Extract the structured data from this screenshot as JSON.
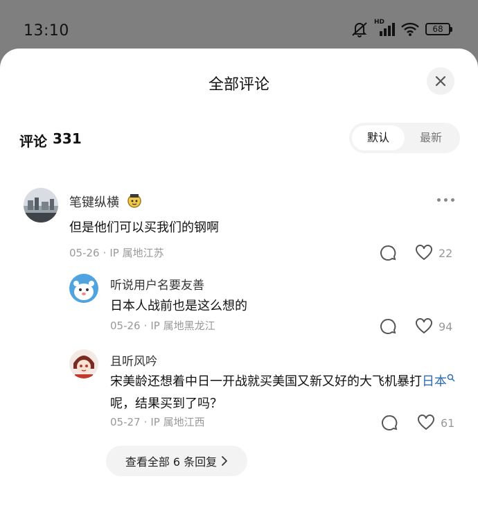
{
  "status_bar": {
    "time": "13:10",
    "network": "HD",
    "battery": "68",
    "icons": [
      "mute-icon",
      "signal-icon",
      "wifi-icon",
      "battery-icon"
    ]
  },
  "sheet": {
    "title": "全部评论",
    "close_icon": "close-icon"
  },
  "comments_header": {
    "label": "评论",
    "count": "331",
    "sort_options": [
      "默认",
      "最新"
    ],
    "sort_selected": "默认"
  },
  "comments": [
    {
      "author": "笔键纵横",
      "badge": "medal-badge",
      "text": "但是他们可以买我们的钢啊",
      "date": "05-26",
      "location": "IP 属地江苏",
      "likes": "22",
      "replies": [
        {
          "author": "听说用户名要友善",
          "text": "日本人战前也是这么想的",
          "date": "05-26",
          "location": "IP 属地黑龙江",
          "likes": "94"
        },
        {
          "author": "且听风吟",
          "text_before": "宋美龄还想着中日一开战就买美国又新又好的大飞机暴打",
          "text_link_1": "日",
          "text_link_2": "本",
          "text_after": "呢，结果买到了吗？",
          "date": "05-27",
          "location": "IP 属地江西",
          "likes": "61"
        }
      ],
      "view_all_replies": "查看全部 6 条回复"
    }
  ],
  "colors": {
    "link": "#2e6bb5",
    "background_dim": "#7f7f7f",
    "sheet": "#ffffff"
  }
}
